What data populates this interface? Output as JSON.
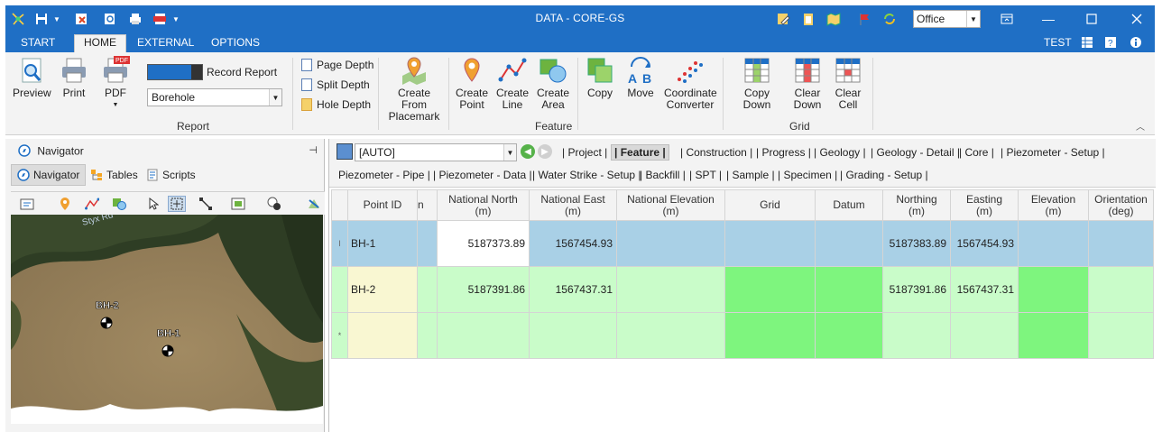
{
  "window": {
    "title": "DATA - CORE-GS",
    "office_combo": "Office"
  },
  "ribbon_tabs": [
    "START",
    "HOME",
    "EXTERNAL",
    "OPTIONS"
  ],
  "user": "TEST",
  "ribbon": {
    "report": {
      "group_label": "Report",
      "preview": "Preview",
      "print": "Print",
      "pdf": "PDF",
      "record_report": "Record Report",
      "borehole_combo": "Borehole",
      "page_depth": "Page Depth",
      "split_depth": "Split Depth",
      "hole_depth": "Hole Depth"
    },
    "feature": {
      "group_label": "Feature",
      "create_from_placemark": [
        "Create From",
        "Placemark"
      ],
      "create_point": [
        "Create",
        "Point"
      ],
      "create_line": [
        "Create",
        "Line"
      ],
      "create_area": [
        "Create",
        "Area"
      ],
      "copy": "Copy",
      "move": "Move",
      "coordinate_converter": [
        "Coordinate",
        "Converter"
      ]
    },
    "grid": {
      "group_label": "Grid",
      "copy_down": "Copy Down",
      "clear_down": [
        "Clear",
        "Down"
      ],
      "clear_cell": [
        "Clear",
        "Cell"
      ]
    }
  },
  "navigator": {
    "title": "Navigator",
    "tabs": [
      "Navigator",
      "Tables",
      "Scripts"
    ],
    "map_labels": {
      "bh2": "BH-2",
      "bh1": "BH-1",
      "road": "Styx Rd"
    }
  },
  "grid_toolbar": {
    "combo": "[AUTO]",
    "tabs_row1": [
      "| Project |",
      "| Feature |",
      "| Construction |",
      "| Progress |",
      "| Geology |",
      "| Geology - Detail |",
      "| Core |",
      "| Piezometer - Setup |"
    ],
    "tabs_row2": [
      "Piezometer - Pipe |",
      "| Piezometer - Data |",
      "| Water Strike - Setup |",
      "| Backfill |",
      "| SPT |",
      "| Sample |",
      "| Specimen |",
      "| Grading - Setup |"
    ]
  },
  "table": {
    "columns": [
      [
        "Point ID",
        ""
      ],
      [
        "n",
        ""
      ],
      [
        "National North",
        "(m)"
      ],
      [
        "National East",
        "(m)"
      ],
      [
        "National Elevation",
        "(m)"
      ],
      [
        "Grid",
        ""
      ],
      [
        "Datum",
        ""
      ],
      [
        "Northing",
        "(m)"
      ],
      [
        "Easting",
        "(m)"
      ],
      [
        "Elevation",
        "(m)"
      ],
      [
        "Orientation",
        "(deg)"
      ]
    ],
    "rows": [
      {
        "indicator": "I",
        "cells": [
          "BH-1",
          "",
          "5187373.89",
          "1567454.93",
          "",
          "",
          "",
          "5187383.89",
          "1567454.93",
          "",
          ""
        ]
      },
      {
        "indicator": "",
        "cells": [
          "BH-2",
          "",
          "5187391.86",
          "1567437.31",
          "",
          "",
          "",
          "5187391.86",
          "1567437.31",
          "",
          ""
        ]
      },
      {
        "indicator": "*",
        "cells": [
          "",
          "",
          "",
          "",
          "",
          "",
          "",
          "",
          "",
          "",
          ""
        ]
      }
    ]
  }
}
